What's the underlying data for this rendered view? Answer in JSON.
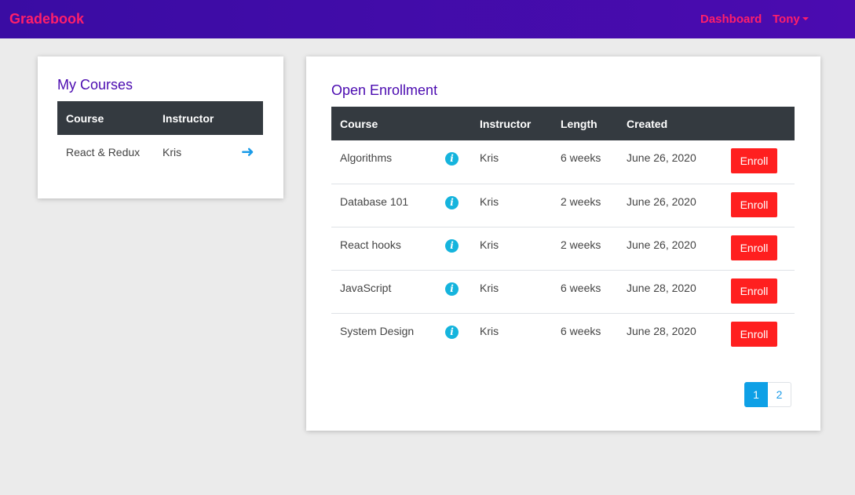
{
  "navbar": {
    "brand": "Gradebook",
    "dashboard_label": "Dashboard",
    "user_label": "Tony",
    "colors": {
      "background": "#4b0bb0",
      "accent": "#ff1f6a"
    }
  },
  "my_courses": {
    "title": "My Courses",
    "headers": [
      "Course",
      "Instructor"
    ],
    "rows": [
      {
        "course": "React & Redux",
        "instructor": "Kris",
        "icon": "arrow-right-icon"
      }
    ]
  },
  "open_enrollment": {
    "title": "Open Enrollment",
    "headers": [
      "Course",
      "",
      "Instructor",
      "Length",
      "Created",
      ""
    ],
    "enroll_label": "Enroll",
    "info_icon_glyph": "i",
    "rows": [
      {
        "course": "Algorithms",
        "instructor": "Kris",
        "length": "6 weeks",
        "created": "June 26, 2020"
      },
      {
        "course": "Database 101",
        "instructor": "Kris",
        "length": "2 weeks",
        "created": "June 26, 2020"
      },
      {
        "course": "React hooks",
        "instructor": "Kris",
        "length": "2 weeks",
        "created": "June 26, 2020"
      },
      {
        "course": "JavaScript",
        "instructor": "Kris",
        "length": "6 weeks",
        "created": "June 28, 2020"
      },
      {
        "course": "System Design",
        "instructor": "Kris",
        "length": "6 weeks",
        "created": "June 28, 2020"
      }
    ],
    "pagination": {
      "pages": [
        "1",
        "2"
      ],
      "current": "1"
    },
    "colors": {
      "enroll_button": "#ff1f1f",
      "info_icon": "#15b4dd",
      "header_bg": "#343a40"
    }
  }
}
